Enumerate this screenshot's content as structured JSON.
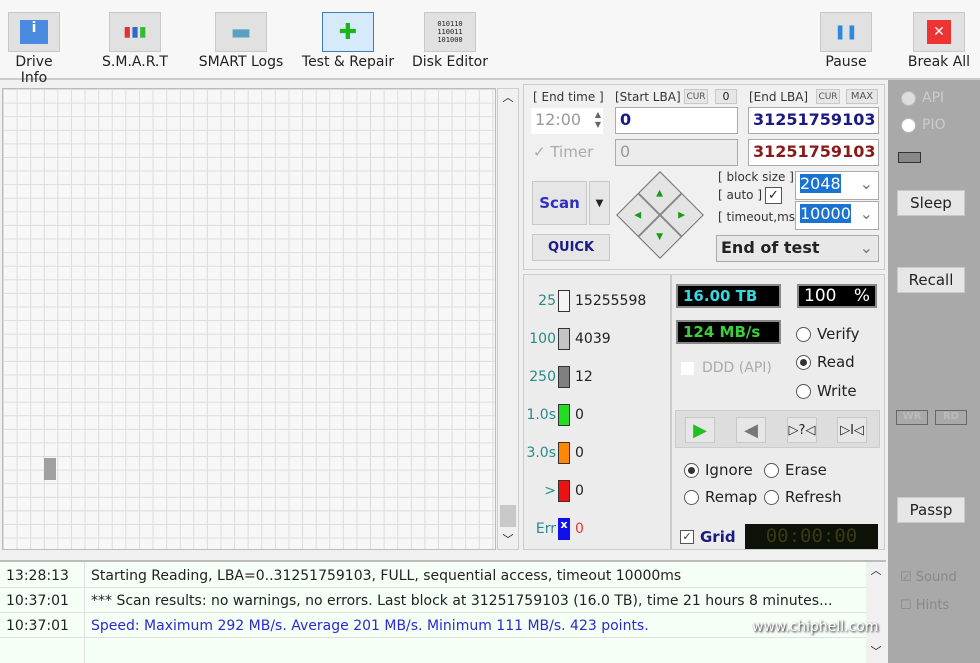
{
  "toolbar": {
    "items": [
      {
        "label": "Drive Info",
        "icon": "info-icon"
      },
      {
        "label": "S.M.A.R.T",
        "icon": "test-tubes-icon"
      },
      {
        "label": "SMART Logs",
        "icon": "folder-edit-icon"
      },
      {
        "label": "Test & Repair",
        "icon": "first-aid-kit-icon",
        "selected": true
      },
      {
        "label": "Disk Editor",
        "icon": "binary-file-icon"
      }
    ],
    "pause": "Pause",
    "break_all": "Break All"
  },
  "params": {
    "end_time_label": "[ End time ]",
    "end_time": "12:00",
    "start_lba_label": "[Start LBA]",
    "cur": "CUR",
    "zero": "0",
    "end_lba_label": "[End LBA]",
    "max": "MAX",
    "start_lba": "0",
    "end_lba": "31251759103",
    "timer_label": "Timer",
    "timer_value": "0",
    "end_lba2": "31251759103",
    "scan": "Scan",
    "quick": "QUICK",
    "block_size_label": "[ block size ]",
    "auto_label": "[ auto ]",
    "timeout_label": "[ timeout,ms ]",
    "block_size": "2048",
    "timeout": "10000",
    "end_action": "End of test"
  },
  "legend": [
    {
      "label": "25",
      "count": "15255598",
      "color": "#f4f4f4"
    },
    {
      "label": "100",
      "count": "4039",
      "color": "#c4c4c4"
    },
    {
      "label": "250",
      "count": "12",
      "color": "#808080"
    },
    {
      "label": "1.0s",
      "count": "0",
      "color": "#22dd22"
    },
    {
      "label": "3.0s",
      "count": "0",
      "color": "#ff8800"
    },
    {
      "label": ">",
      "count": "0",
      "color": "#ee1111"
    },
    {
      "label": "Err",
      "count": "0",
      "color": "#1010ee"
    }
  ],
  "status": {
    "size": "16.00 TB",
    "percent": "100",
    "percent_unit": "%",
    "speed": "124 MB/s",
    "ddd": "DDD (API)",
    "verify": "Verify",
    "read": "Read",
    "write": "Write",
    "ignore": "Ignore",
    "erase": "Erase",
    "remap": "Remap",
    "refresh": "Refresh",
    "grid": "Grid",
    "timer": "00:00:00",
    "progress_percent": 100
  },
  "side": {
    "api": "API",
    "pio": "PIO",
    "sleep": "Sleep",
    "recall": "Recall",
    "wr": "WR",
    "rd": "RD",
    "passp": "Passp",
    "sound": "Sound",
    "hints": "Hints"
  },
  "log": [
    {
      "time": "13:28:13",
      "msg": "Starting Reading, LBA=0..31251759103, FULL, sequential access, timeout 10000ms",
      "color": "#222222"
    },
    {
      "time": "10:37:01",
      "msg": "*** Scan results: no warnings, no errors. Last block at 31251759103 (16.0 TB), time 21 hours 8 minutes...",
      "color": "#222222"
    },
    {
      "time": "10:37:01",
      "msg": "Speed: Maximum 292 MB/s. Average 201 MB/s. Minimum 111 MB/s. 423 points.",
      "color": "#2a2ad0"
    }
  ],
  "watermark": "www.chiphell.com"
}
